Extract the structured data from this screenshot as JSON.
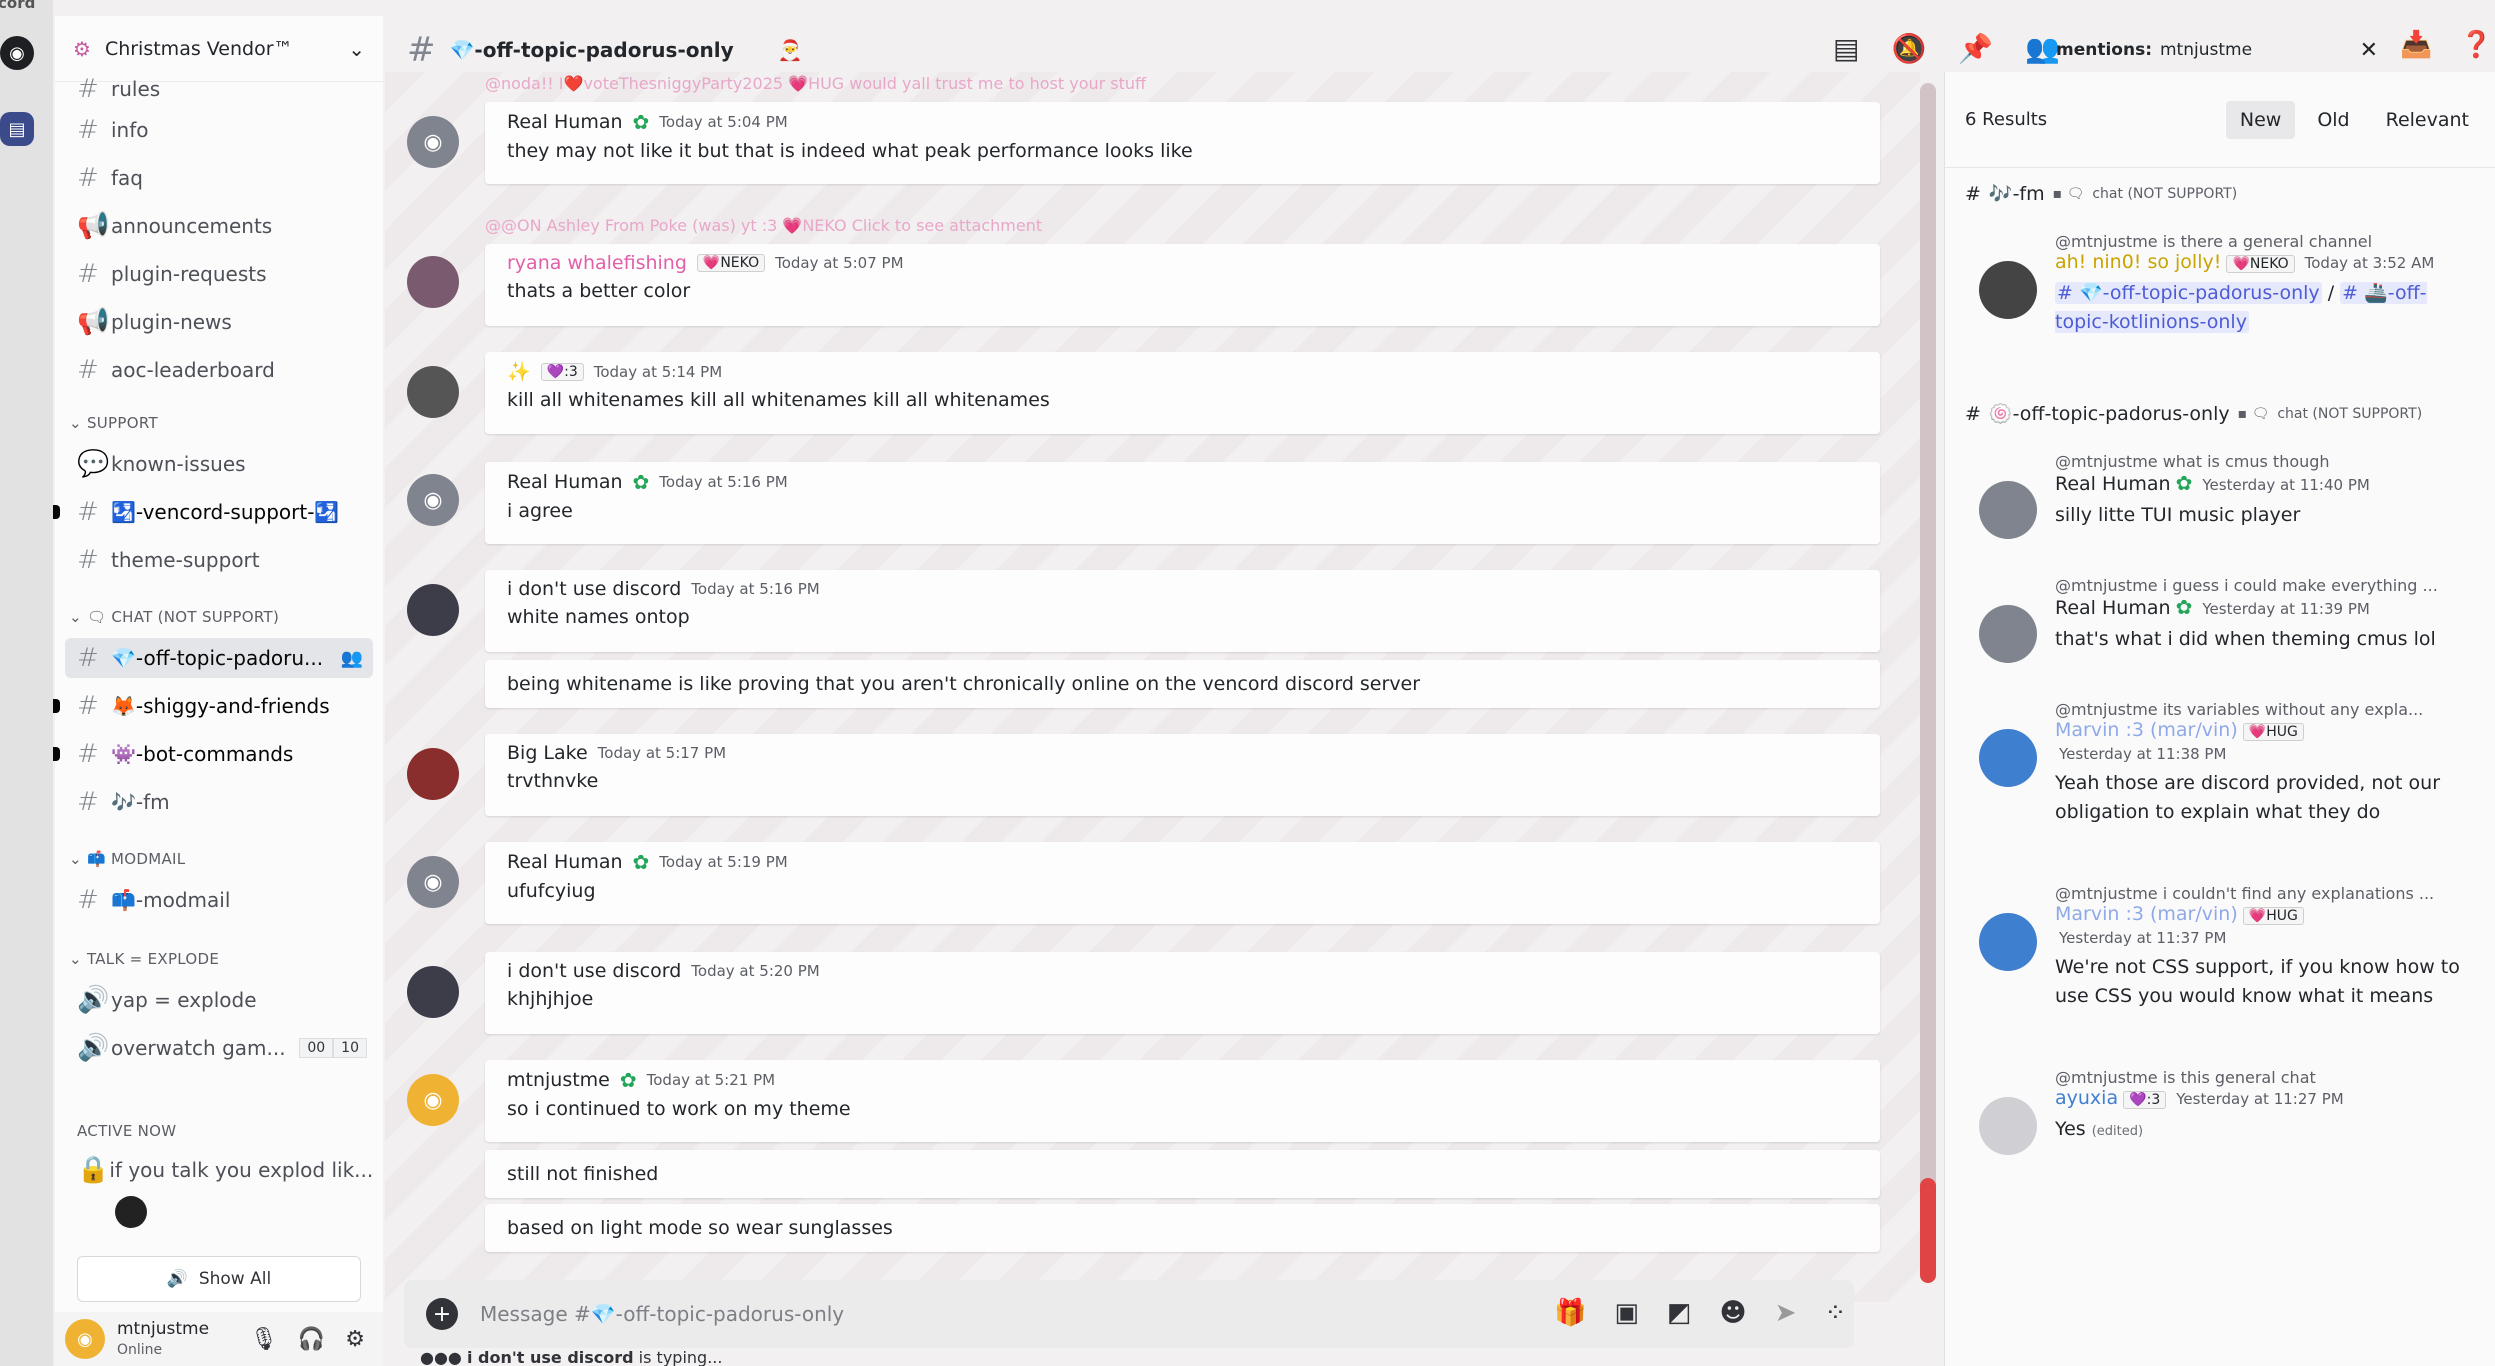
{
  "app": {
    "title_fragment": "cord"
  },
  "guild": {
    "name": "Christmas Vendor™"
  },
  "channels": [
    {
      "name": "rules",
      "type": "text"
    },
    {
      "name": "info",
      "type": "text"
    },
    {
      "name": "faq",
      "type": "text"
    },
    {
      "name": "announcements",
      "type": "announce"
    },
    {
      "name": "plugin-requests",
      "type": "text"
    },
    {
      "name": "plugin-news",
      "type": "announce"
    },
    {
      "name": "aoc-leaderboard",
      "type": "text"
    }
  ],
  "categories": {
    "support": "SUPPORT",
    "chat": "CHAT (NOT SUPPORT)",
    "modmail": "MODMAIL",
    "talk": "TALK = EXPLODE",
    "active": "ACTIVE NOW"
  },
  "support_channels": [
    {
      "name": "known-issues"
    },
    {
      "name": "🛂-vencord-support-🛂"
    },
    {
      "name": "theme-support"
    }
  ],
  "chat_channels": [
    {
      "name": "💎-off-topic-padoru..."
    },
    {
      "name": "🦊-shiggy-and-friends"
    },
    {
      "name": "👾-bot-commands"
    },
    {
      "name": "🎶-fm"
    }
  ],
  "modmail_channels": [
    {
      "name": "📫-modmail"
    }
  ],
  "voice_channels": [
    {
      "name": "yap = explode"
    },
    {
      "name": "overwatch gam...",
      "count_a": "00",
      "count_b": "10"
    }
  ],
  "active_now": {
    "text": "if you talk you explod lik..."
  },
  "show_all": "Show All",
  "user": {
    "name": "mtnjustme",
    "status": "Online"
  },
  "header": {
    "channel": "💎-off-topic-padorus-only"
  },
  "search": {
    "label": "mentions:",
    "value": "mtnjustme"
  },
  "messages": [
    {
      "reply": "@noda!! I❤️voteThesniggyParty2025 💗HUG  would yall trust me to host your stuff",
      "author": "Real Human",
      "time": "Today at 5:04 PM",
      "lines": [
        "they may not like it but that is indeed what peak performance looks like"
      ]
    },
    {
      "reply": "@@ON Ashley From Poke (was) yt :3  💗NEKO  Click to see attachment",
      "author": "ryana whalefishing",
      "tag": "💗NEKO",
      "time": "Today at 5:07 PM",
      "lines": [
        "thats a better color"
      ]
    },
    {
      "author": "✨",
      "tag": "💜:3",
      "time": "Today at 5:14 PM",
      "lines": [
        "kill all whitenames kill all whitenames kill all whitenames"
      ]
    },
    {
      "author": "Real Human",
      "time": "Today at 5:16 PM",
      "lines": [
        "i agree"
      ]
    },
    {
      "author": "i don't use discord",
      "time": "Today at 5:16 PM",
      "lines": [
        "white names ontop",
        "being whitename is like proving that you aren't chronically online on the vencord discord server"
      ]
    },
    {
      "author": "Big Lake",
      "time": "Today at 5:17 PM",
      "lines": [
        "trvthnvke"
      ]
    },
    {
      "author": "Real Human",
      "time": "Today at 5:19 PM",
      "lines": [
        "ufufcyiug"
      ]
    },
    {
      "author": "i don't use discord",
      "time": "Today at 5:20 PM",
      "lines": [
        "khjhjhjoe"
      ]
    },
    {
      "author": "mtnjustme",
      "time": "Today at 5:21 PM",
      "lines": [
        "so i continued to work on my theme",
        "still not finished",
        "based on light mode so wear sunglasses"
      ]
    }
  ],
  "composer": {
    "placeholder": "Message #💎-off-topic-padorus-only"
  },
  "typing": {
    "who": "i don't use discord",
    "text": " is typing..."
  },
  "results": {
    "count": "6 Results",
    "sorts": [
      "New",
      "Old",
      "Relevant"
    ],
    "groups": [
      {
        "channel": "🎶-fm",
        "category": "chat (NOT SUPPORT)"
      },
      {
        "channel": "🍥-off-topic-padorus-only",
        "category": "chat (NOT SUPPORT)"
      }
    ],
    "items": [
      {
        "reply": "@mtnjustme is there a general channel",
        "author": "ah! nin0! so jolly!",
        "tag": "💗NEKO",
        "time": "Today at 3:52 AM",
        "link1": "# 💎-off-topic-padorus-only",
        "sep": " / ",
        "link2": "# 🚢-off-topic-kotlinions-only"
      },
      {
        "reply": "@mtnjustme what is cmus though",
        "author": "Real Human",
        "time": "Yesterday at 11:40 PM",
        "text": "silly litte TUI music player"
      },
      {
        "reply": "@mtnjustme i guess i could make everything ...",
        "author": "Real Human",
        "time": "Yesterday at 11:39 PM",
        "text": "that's what i did when theming cmus lol"
      },
      {
        "reply": "@mtnjustme its variables without any expla...",
        "author": "Marvin :3 (mar/vin)",
        "tag": "💗HUG",
        "time": "Yesterday at 11:38 PM",
        "text": "Yeah those are discord provided, not our obligation to explain what they do"
      },
      {
        "reply": "@mtnjustme i couldn't find any explanations ...",
        "author": "Marvin :3 (mar/vin)",
        "tag": "💗HUG",
        "time": "Yesterday at 11:37 PM",
        "text": "We're not CSS support, if you know how to use CSS you would know what it means"
      },
      {
        "reply": "@mtnjustme is this general chat",
        "author": "ayuxia",
        "tag": "💜:3",
        "time": "Yesterday at 11:27 PM",
        "text": "Yes",
        "edited": "(edited)"
      }
    ]
  },
  "colors": {
    "accent": "#e04444",
    "link": "#4e5bd6",
    "pink": "#e35fa8",
    "gold": "#c9a300",
    "marvin": "#8fa9e8"
  }
}
